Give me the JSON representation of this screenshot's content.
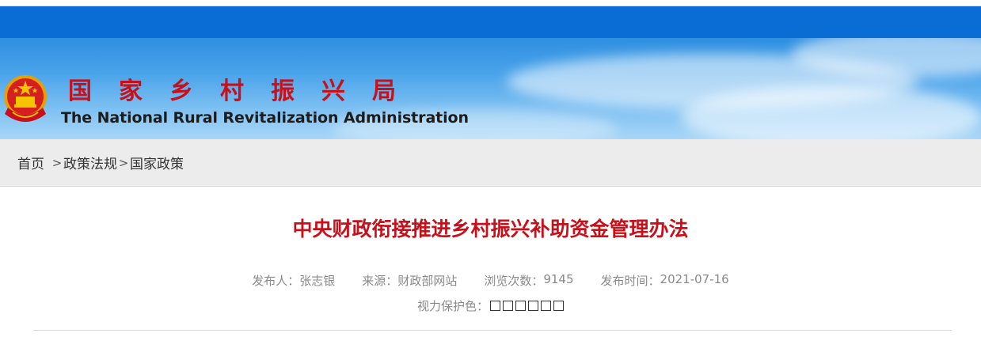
{
  "header": {
    "site_name_cn": "国家乡村振兴局",
    "site_name_en": "The National Rural Revitalization Administration"
  },
  "breadcrumb": {
    "items": [
      "首页",
      "政策法规",
      "国家政策"
    ],
    "separator": ">"
  },
  "article": {
    "title": "中央财政衔接推进乡村振兴补助资金管理办法",
    "meta": {
      "publisher_label": "发布人：",
      "publisher": "张志银",
      "source_label": "来源：",
      "source": "财政部网站",
      "views_label": "浏览次数：",
      "views": "9145",
      "date_label": "发布时间：",
      "date": "2021-07-16"
    },
    "eye_protection": {
      "label": "视力保护色：",
      "swatch_count": 6
    }
  },
  "colors": {
    "nav_blue": "#0a6dd6",
    "title_red": "#c8101a",
    "breadcrumb_bg": "#ececec",
    "meta_gray": "#8a8a8a"
  },
  "icons": {
    "emblem": "national-emblem-icon",
    "separator": "chevron-right-icon"
  }
}
